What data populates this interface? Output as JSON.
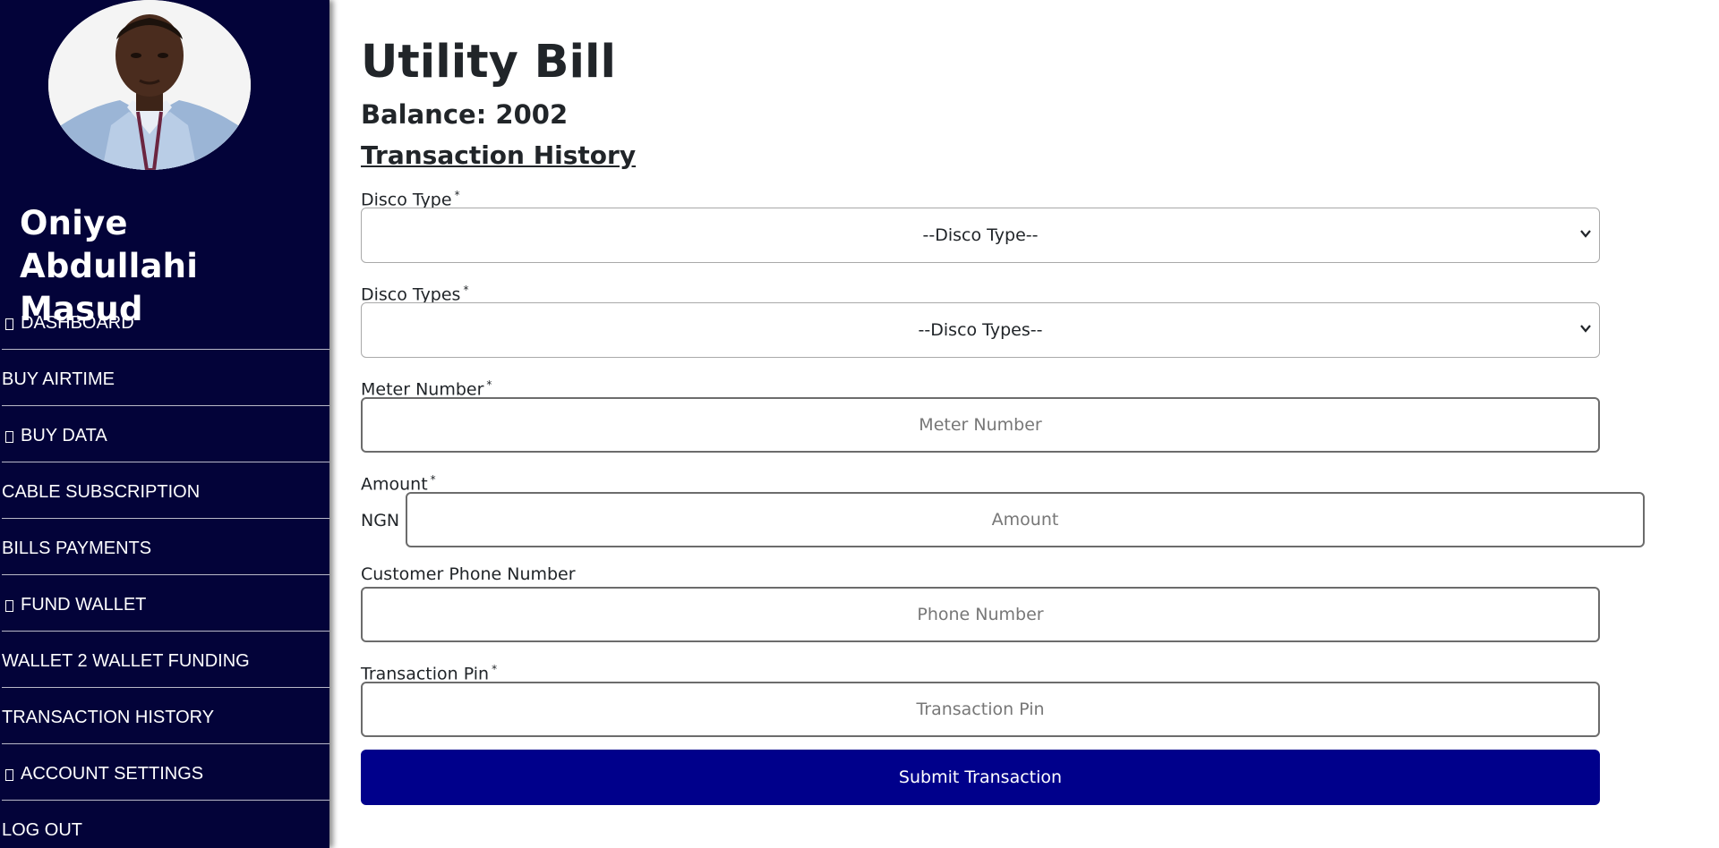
{
  "user": {
    "name": "Oniye Abdullahi Masud"
  },
  "sidebar": {
    "items": [
      {
        "label": "DASHBOARD",
        "icon": "glyph-placeholder-icon"
      },
      {
        "label": "BUY AIRTIME"
      },
      {
        "label": "BUY DATA",
        "icon": "glyph-placeholder-icon"
      },
      {
        "label": "CABLE SUBSCRIPTION"
      },
      {
        "label": "BILLS PAYMENTS"
      },
      {
        "label": "FUND WALLET",
        "icon": "glyph-placeholder-icon"
      },
      {
        "label": "WALLET 2 WALLET FUNDING"
      },
      {
        "label": "TRANSACTION HISTORY"
      },
      {
        "label": "ACCOUNT SETTINGS",
        "icon": "glyph-placeholder-icon"
      },
      {
        "label": "LOG OUT"
      }
    ]
  },
  "main": {
    "title": "Utility Bill",
    "balance_label": "Balance:",
    "balance_value": "2002",
    "history_link": "Transaction History"
  },
  "form": {
    "disco_type": {
      "label": "Disco Type",
      "required": "*",
      "selected": "--Disco Type--"
    },
    "disco_types": {
      "label": "Disco Types",
      "required": "*",
      "selected": "--Disco Types--"
    },
    "meter_number": {
      "label": "Meter Number",
      "required": "*",
      "placeholder": "Meter Number",
      "value": ""
    },
    "amount": {
      "label": "Amount",
      "required": "*",
      "prefix": "NGN",
      "placeholder": "Amount",
      "value": ""
    },
    "phone": {
      "label": "Customer Phone Number",
      "placeholder": "Phone Number",
      "value": ""
    },
    "pin": {
      "label": "Transaction Pin",
      "required": "*",
      "placeholder": "Transaction Pin",
      "value": ""
    },
    "submit_label": "Submit Transaction"
  },
  "colors": {
    "sidebar_bg": "#030339",
    "button_bg": "#00008b",
    "text": "#212529"
  }
}
